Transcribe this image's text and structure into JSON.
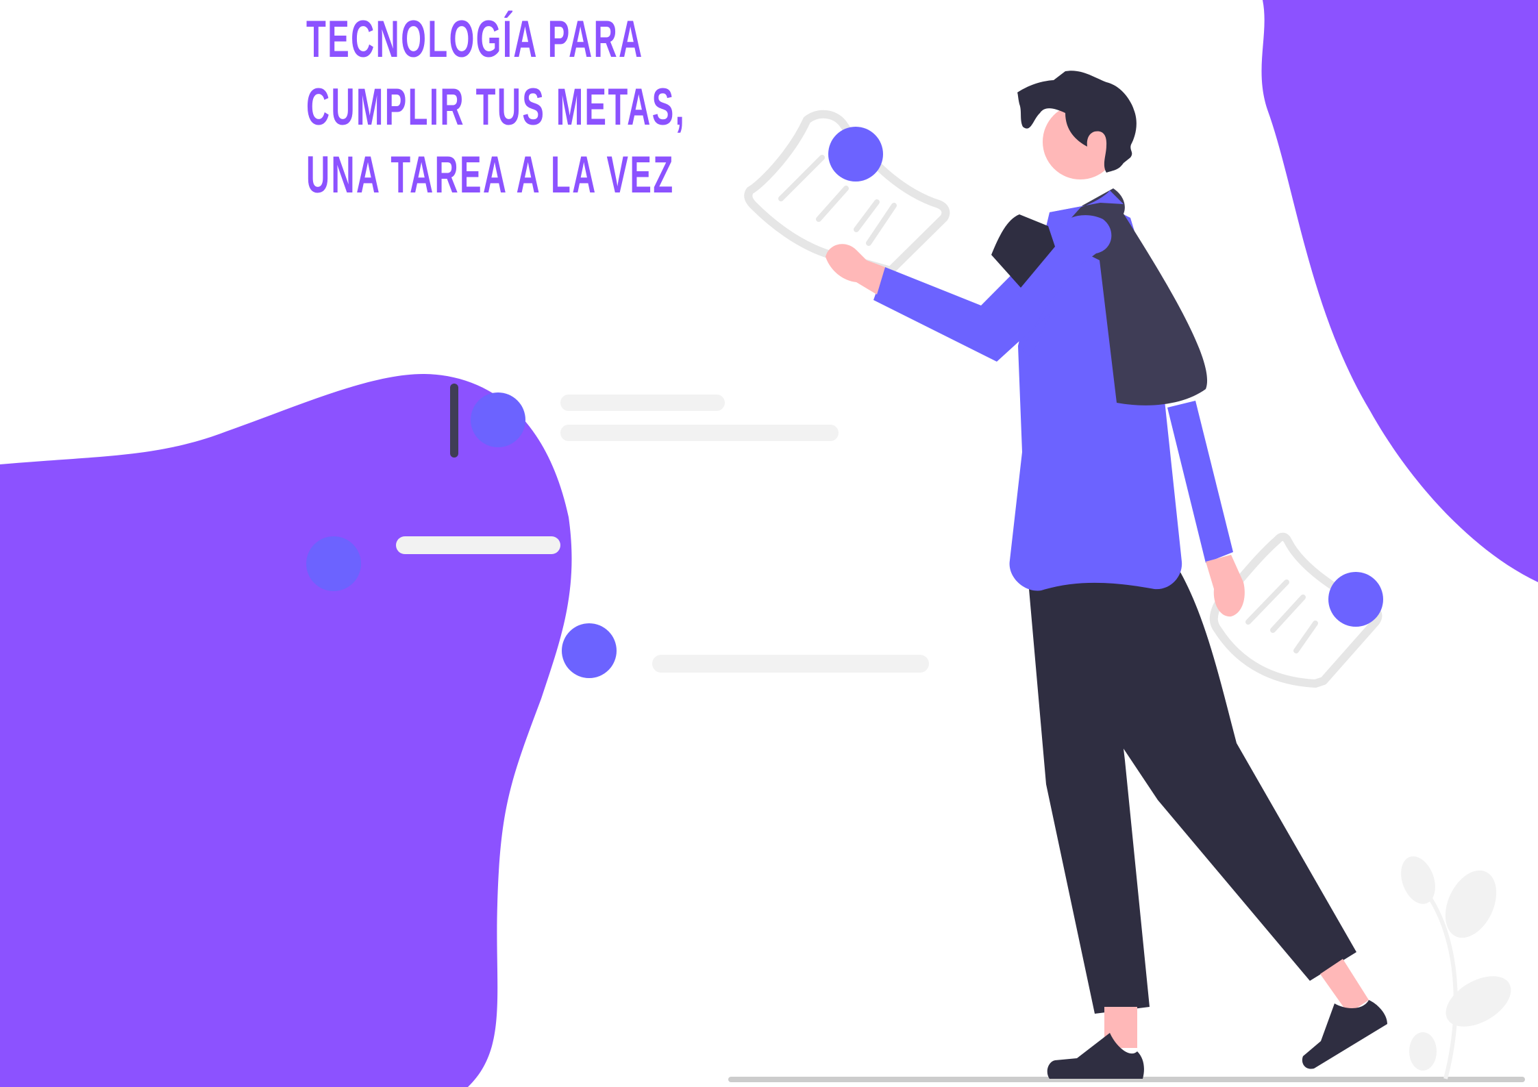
{
  "headline": {
    "line1": "TECNOLOGÍA PARA",
    "line2": "CUMPLIR TUS METAS,",
    "line3": "UNA TAREA A LA VEZ"
  },
  "colors": {
    "brand_purple": "#8c52ff",
    "accent_blue": "#6c63ff",
    "skin": "#ffb8b8",
    "dark": "#2f2e41",
    "vest": "#3f3d56",
    "light_gray": "#f2f2f2",
    "line_gray": "#e6e6e6",
    "floor": "#cccccc"
  },
  "illustration": {
    "subject": "person-walking-reading-document",
    "icons": [
      "document-icon",
      "document-icon",
      "bullet-dot-icon"
    ]
  }
}
